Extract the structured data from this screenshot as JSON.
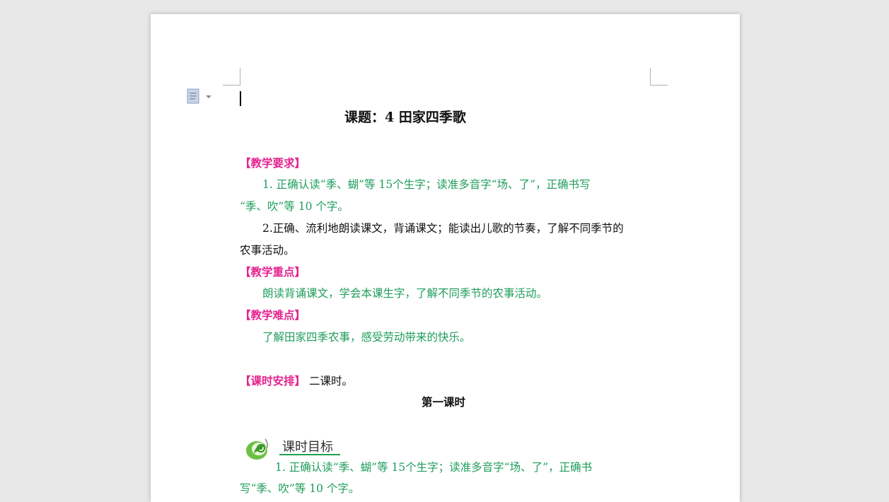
{
  "document": {
    "title": "课题：4  田家四季歌",
    "section1": {
      "heading": "【教学要求】",
      "item1_line1": "1. 正确认读“季、蝴”等 15个生字；读准多音字“场、了”，正确书写",
      "item1_line2": "“季、吹”等 10 个字。",
      "item2_line1": "2.正确、流利地朗读课文，背诵课文；能读出儿歌的节奏，了解不同季节的",
      "item2_line2": "农事活动。"
    },
    "section2": {
      "heading": "【教学重点】",
      "text": "朗读背诵课文，学会本课生字，了解不同季节的农事活动。"
    },
    "section3": {
      "heading": "【教学难点】",
      "text": "了解田家四季农事，感受劳动带来的快乐。"
    },
    "section4": {
      "heading": "【课时安排】",
      "text": "二课时。"
    },
    "lesson_title": "第一课时",
    "objective_label": "课时目标",
    "objective1_line1": "1. 正确认读“季、蝴”等 15个生字；读准多音字“场、了”，正确书",
    "objective1_line2": "写“季、吹”等 10 个字。"
  },
  "colors": {
    "heading": "#e4238f",
    "green_text": "#1e9d5b",
    "page": "#ffffff",
    "background": "#e8e8e8"
  },
  "icons": {
    "paste": "paste-options-icon",
    "objective": "leaf-badge-icon"
  }
}
